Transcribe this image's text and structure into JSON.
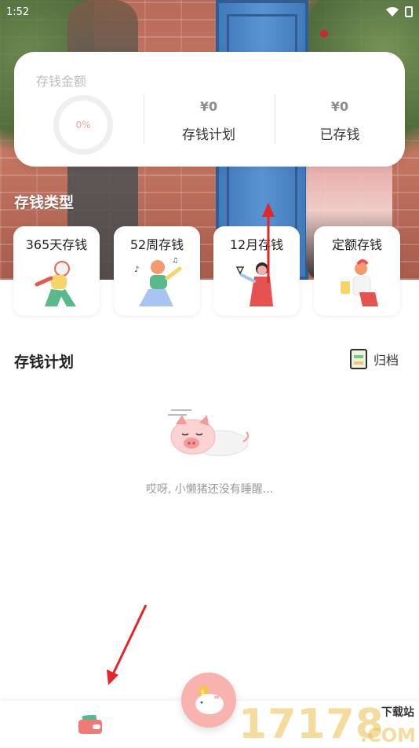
{
  "status_bar": {
    "time": "1:52"
  },
  "summary": {
    "label": "存钱金额",
    "progress_text": "0%",
    "progress_value": 0,
    "plan_amount": "¥0",
    "plan_label": "存钱计划",
    "saved_amount": "¥0",
    "saved_label": "已存钱"
  },
  "types": {
    "title": "存钱类型",
    "items": [
      {
        "label": "365天存钱"
      },
      {
        "label": "52周存钱"
      },
      {
        "label": "12月存钱"
      },
      {
        "label": "定额存钱"
      }
    ]
  },
  "plans": {
    "title": "存钱计划",
    "archive_label": "归档",
    "empty_message": "哎呀, 小懒猪还没有睡醒..."
  },
  "bottom_nav": {
    "wallet_icon": "wallet-icon",
    "fab_icon": "piggy-bank-icon"
  },
  "watermark": {
    "text": "17178",
    "subtitle": "下载站",
    "domain": ".COM"
  },
  "colors": {
    "accent_pink": "#f8b3ae",
    "annotation_red": "#e32626"
  }
}
